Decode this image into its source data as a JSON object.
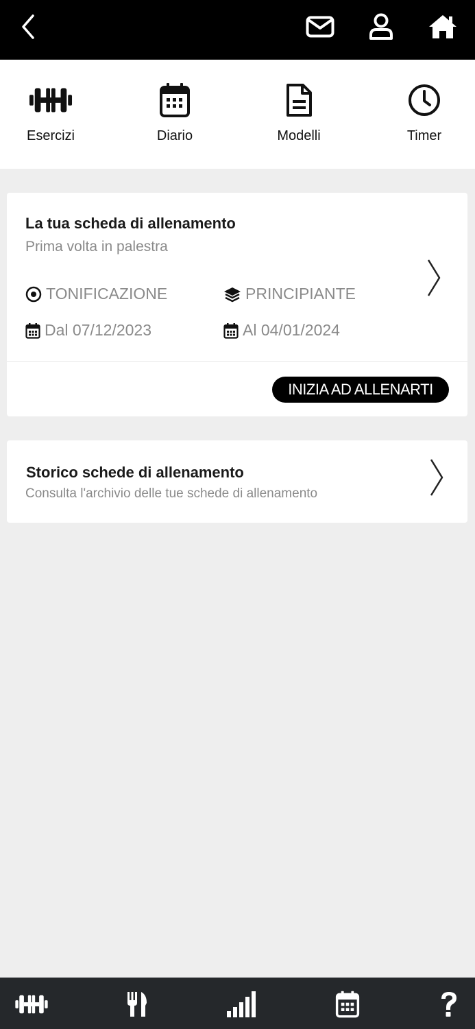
{
  "header": {
    "back_icon": "chevron-left-icon",
    "mail_icon": "envelope-icon",
    "profile_icon": "user-icon",
    "home_icon": "home-icon"
  },
  "quicknav": {
    "items": [
      {
        "label": "Esercizi",
        "icon": "dumbbell-icon"
      },
      {
        "label": "Diario",
        "icon": "calendar-icon"
      },
      {
        "label": "Modelli",
        "icon": "document-icon"
      },
      {
        "label": "Timer",
        "icon": "clock-icon"
      }
    ]
  },
  "workout_card": {
    "title": "La tua scheda di allenamento",
    "subtitle": "Prima volta in palestra",
    "goal": "TONIFICAZIONE",
    "level": "PRINCIPIANTE",
    "start": "Dal 07/12/2023",
    "end": "Al 04/01/2024",
    "cta_label": "INIZIA AD ALLENARTI"
  },
  "history_card": {
    "title": "Storico schede di allenamento",
    "subtitle": "Consulta l'archivio delle tue schede di allenamento"
  },
  "bottom_nav": {
    "items": [
      "dumbbell-icon",
      "cutlery-icon",
      "signal-bars-icon",
      "calendar-icon",
      "question-icon"
    ]
  },
  "colors": {
    "topbar": "#000000",
    "bottombar": "#25282b",
    "background": "#eeeeee",
    "muted_text": "#8a8a8a"
  }
}
